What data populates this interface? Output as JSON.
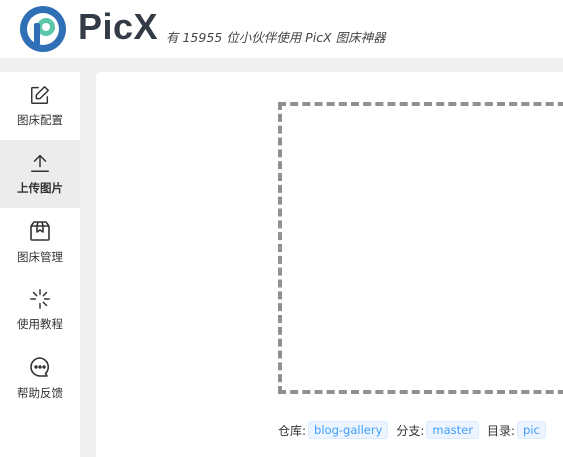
{
  "app": {
    "name": "PicX",
    "tagline": "有 15955 位小伙伴使用 PicX 图床神器"
  },
  "sidebar": {
    "items": [
      {
        "label": "图床配置",
        "icon": "edit-icon",
        "active": false
      },
      {
        "label": "上传图片",
        "icon": "upload-icon",
        "active": true
      },
      {
        "label": "图床管理",
        "icon": "box-icon",
        "active": false
      },
      {
        "label": "使用教程",
        "icon": "loading-icon",
        "active": false
      },
      {
        "label": "帮助反馈",
        "icon": "chat-icon",
        "active": false
      }
    ]
  },
  "repo": {
    "repo_label": "仓库:",
    "repo_value": "blog-gallery",
    "branch_label": "分支:",
    "branch_value": "master",
    "dir_label": "目录:",
    "dir_value": "pic"
  },
  "colors": {
    "accent": "#409eff",
    "logo_blue": "#2f6fb5",
    "logo_green": "#5cc6a8"
  }
}
